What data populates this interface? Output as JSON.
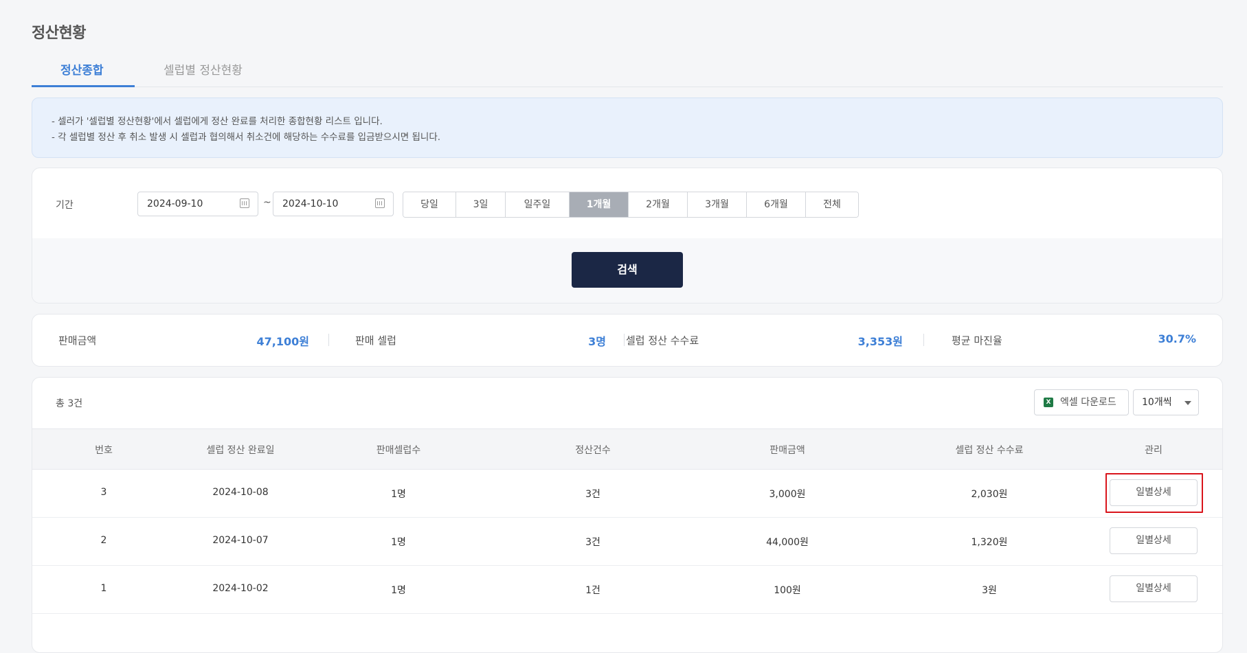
{
  "page": {
    "title": "정산현황"
  },
  "tabs": [
    {
      "label": "정산종합",
      "active": true
    },
    {
      "label": "셀럽별 정산현황",
      "active": false
    }
  ],
  "notice": {
    "lines": [
      "- 셀러가 '셀럽별 정산현황'에서 셀럽에게 정산 완료를 처리한 종합현황 리스트 입니다.",
      "- 각 셀럽별 정산 후 취소 발생 시 셀럽과 협의해서 취소건에 해당하는 수수료를 입금받으시면 됩니다."
    ]
  },
  "filter": {
    "period_label": "기간",
    "start_date": "2024-09-10",
    "end_date": "2024-10-10",
    "separator": "~",
    "period_buttons": [
      "당일",
      "3일",
      "일주일",
      "1개월",
      "2개월",
      "3개월",
      "6개월",
      "전체"
    ],
    "active_period": "1개월",
    "search_label": "검색"
  },
  "summary": [
    {
      "label": "판매금액",
      "value": "47,100원"
    },
    {
      "label": "판매 셀럽",
      "value": "3명"
    },
    {
      "label": "셀럽 정산 수수료",
      "value": "3,353원"
    },
    {
      "label": "평균 마진율",
      "value": "30.7%"
    }
  ],
  "table": {
    "total": "총 3건",
    "excel_label": "엑셀 다운로드",
    "excel_icon": "excel-icon",
    "page_size": "10개씩",
    "columns": [
      "번호",
      "셀럽 정산 완료일",
      "판매셀럽수",
      "정산건수",
      "판매금액",
      "셀럽 정산 수수료",
      "관리"
    ],
    "rows": [
      {
        "no": "3",
        "date": "2024-10-08",
        "celebs": "1명",
        "count": "3건",
        "amount": "3,000원",
        "fee": "2,030원",
        "action": "일별상세",
        "highlighted": true
      },
      {
        "no": "2",
        "date": "2024-10-07",
        "celebs": "1명",
        "count": "3건",
        "amount": "44,000원",
        "fee": "1,320원",
        "action": "일별상세"
      },
      {
        "no": "1",
        "date": "2024-10-02",
        "celebs": "1명",
        "count": "1건",
        "amount": "100원",
        "fee": "3원",
        "action": "일별상세"
      }
    ]
  },
  "colors": {
    "accent": "#3d7fd6",
    "primary_button": "#1b2745",
    "highlight": "#d9141b"
  }
}
